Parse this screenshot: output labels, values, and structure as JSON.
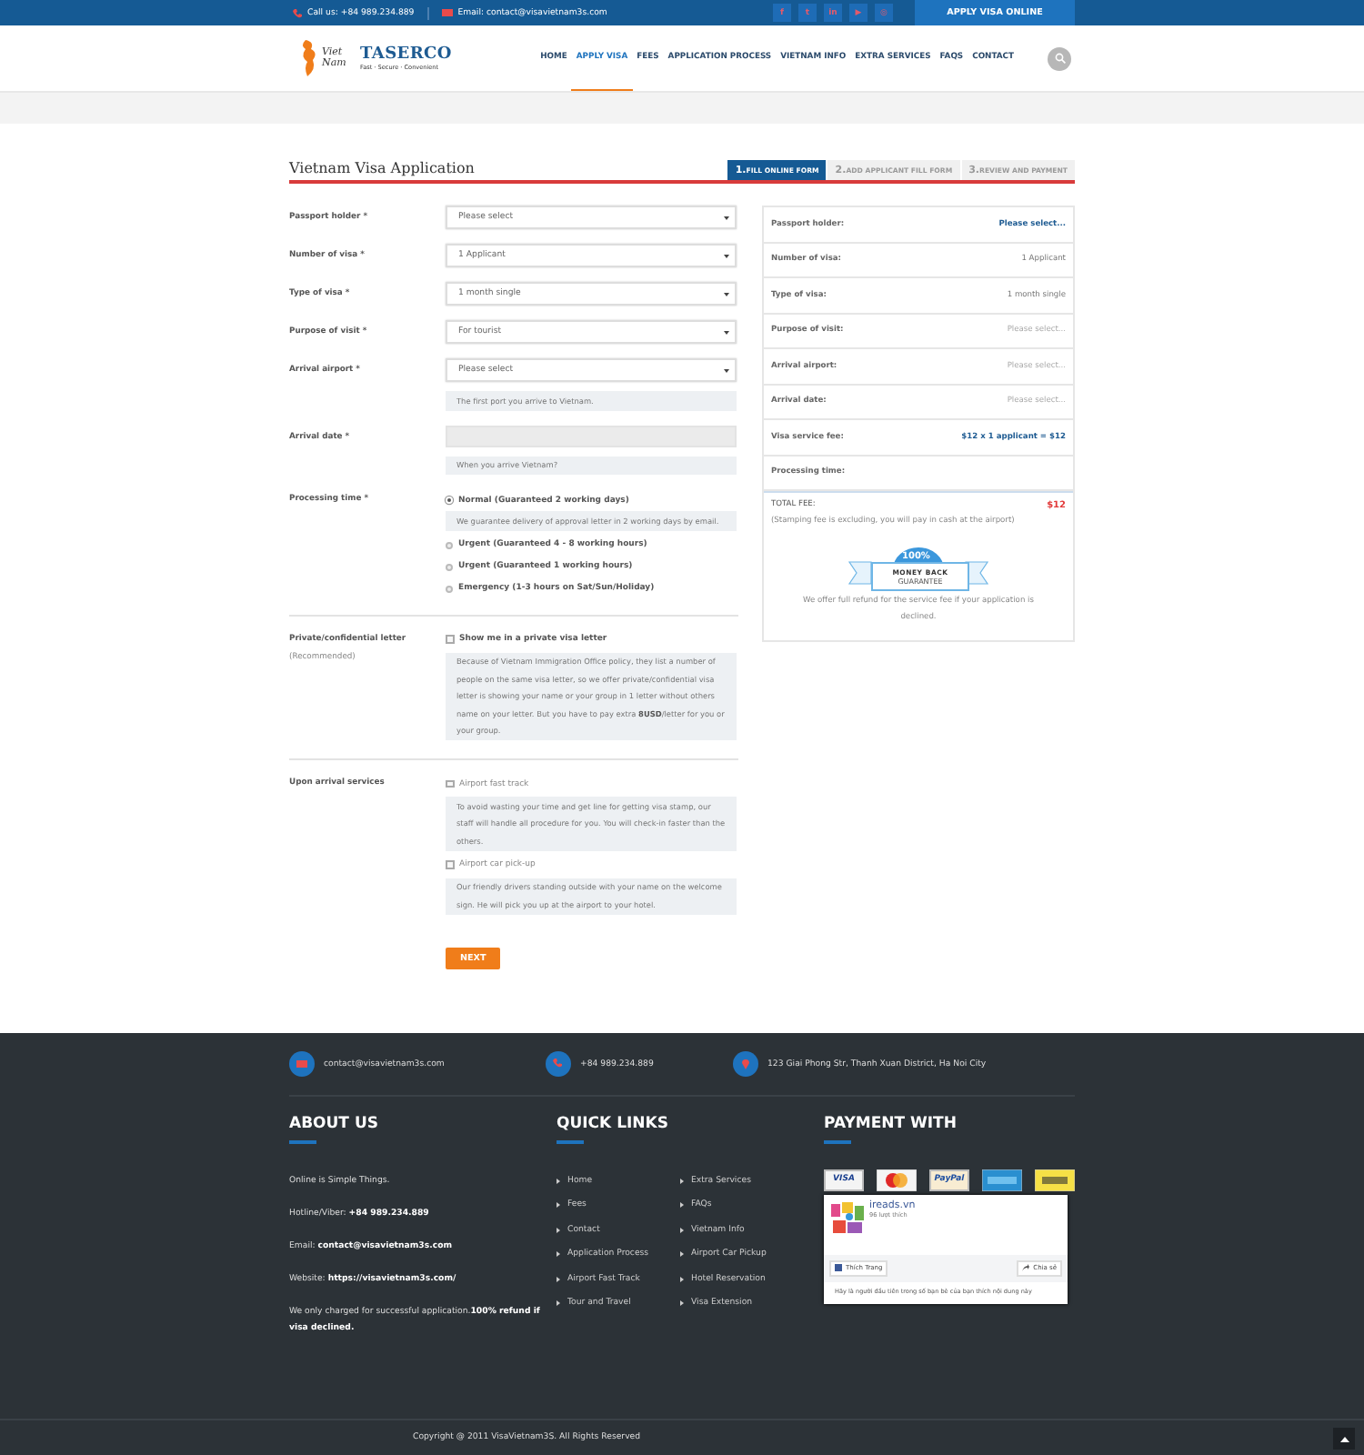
{
  "topbar": {
    "phone": "Call us: +84 989.234.889",
    "email": "Email: contact@visavietnam3s.com",
    "social": [
      {
        "glyph": "f"
      },
      {
        "glyph": "t"
      },
      {
        "glyph": "in"
      },
      {
        "glyph": "▶"
      },
      {
        "glyph": "◎"
      }
    ],
    "apply_button": "APPLY VISA ONLINE"
  },
  "header": {
    "logo": {
      "script": "Viet Nam",
      "name": "TASERCO",
      "tagline": "Fast · Secure · Convenient"
    },
    "nav": [
      {
        "label": "HOME",
        "selected": false
      },
      {
        "label": "APPLY VISA",
        "selected": true
      },
      {
        "label": "FEES",
        "selected": false
      },
      {
        "label": "APPLICATION PROCESS",
        "selected": false
      },
      {
        "label": "VIETNAM INFO",
        "selected": false
      },
      {
        "label": "EXTRA SERVICES",
        "selected": false
      },
      {
        "label": "FAQS",
        "selected": false
      },
      {
        "label": "CONTACT",
        "selected": false
      }
    ]
  },
  "form": {
    "title": "Vietnam Visa Application",
    "steps": [
      {
        "number": "1.",
        "label": "FILL ONLINE FORM",
        "selected": true
      },
      {
        "number": "2.",
        "label": "ADD APPLICANT FILL FORM",
        "selected": false
      },
      {
        "number": "3.",
        "label": "REVIEW AND PAYMENT",
        "selected": false
      }
    ],
    "fields": [
      {
        "kind": "select",
        "label": "Passport holder *",
        "value": "Please select"
      },
      {
        "kind": "select",
        "label": "Number of visa *",
        "value": "1 Applicant"
      },
      {
        "kind": "select",
        "label": "Type of visa *",
        "value": "1 month single"
      },
      {
        "kind": "select",
        "label": "Purpose of visit *",
        "value": "For tourist"
      },
      {
        "kind": "select",
        "label": "Arrival airport *",
        "value": "Please select",
        "hint": "The first port you arrive to Vietnam."
      },
      {
        "kind": "date",
        "label": "Arrival date *",
        "hint": "When you arrive Vietnam?"
      },
      {
        "kind": "radio",
        "label": "Processing time *",
        "options": [
          {
            "label": "Normal (Guaranteed 2 working days)",
            "selected": true,
            "hint": "We guarantee delivery of approval letter in 2 working days by email."
          },
          {
            "label": "Urgent (Guaranteed 4 - 8 working hours)",
            "selected": false
          },
          {
            "label": "Urgent (Guaranteed 1 working hours)",
            "selected": false
          },
          {
            "label": "Emergency (1-3 hours on Sat/Sun/Holiday)",
            "selected": false
          }
        ]
      },
      {
        "kind": "checks",
        "label": "Private/confidential letter",
        "sublabel": "(Recommended)",
        "options": [
          {
            "label": "Show me in a private visa letter",
            "checked": false,
            "emphasis": true,
            "hint": "Because of Vietnam Immigration Office policy, they list a number of people on the same visa letter, so we offer private/confidential visa letter is showing your name or your group in 1 letter without others name on your letter. But you have to pay extra **8USD**/letter for you or your group."
          }
        ]
      },
      {
        "kind": "checks",
        "label": "Upon arrival services",
        "options": [
          {
            "label": "Airport fast track",
            "checked": false,
            "emphasis": false,
            "hint": "To avoid wasting your time and get line for getting visa stamp, our staff will handle all procedure for you. You will check-in faster than the others."
          },
          {
            "label": "Airport car pick-up",
            "checked": false,
            "emphasis": false,
            "hint": "Our friendly drivers standing outside with your name on the welcome sign. He will pick you up at the airport to your hotel."
          }
        ]
      }
    ],
    "next_button": "NEXT"
  },
  "summary": {
    "rows": [
      {
        "label": "Passport holder:",
        "value": "Please select...",
        "kind": "emphasis"
      },
      {
        "label": "Number of visa:",
        "value": "1 Applicant",
        "kind": "value"
      },
      {
        "label": "Type of visa:",
        "value": "1 month single",
        "kind": "value"
      },
      {
        "label": "Purpose of visit:",
        "value": "Please select...",
        "kind": "placeholder"
      },
      {
        "label": "Arrival airport:",
        "value": "Please select...",
        "kind": "placeholder"
      },
      {
        "label": "Arrival date:",
        "value": "Please select...",
        "kind": "placeholder"
      },
      {
        "label": "Visa service fee:",
        "value": "$12 x 1 applicant = $12",
        "kind": "emphasis"
      },
      {
        "label": "Processing time:"
      }
    ],
    "total_label": "TOTAL FEE:",
    "total": "$12",
    "note": "(Stamping fee is excluding, you will pay in cash at the airport)",
    "badge": {
      "percent": "100%",
      "line1": "MONEY BACK",
      "line2": "GUARANTEE"
    },
    "refund": "We offer full refund for the service fee if your application is declined."
  },
  "footer": {
    "contacts": [
      {
        "kind": "mail",
        "text": "contact@visavietnam3s.com"
      },
      {
        "kind": "phone",
        "text": "+84 989.234.889"
      },
      {
        "kind": "pin",
        "text": "123 Giai Phong Str, Thanh Xuan District, Ha Noi City"
      }
    ],
    "about": {
      "heading": "ABOUT US",
      "paragraphs": [
        "Online is Simple Things.",
        "Hotline/Viber: **+84 989.234.889**",
        "Email: **contact@visavietnam3s.com**",
        "Website: **https://visavietnam3s.com/**",
        "We only charged for successful application.**100% refund if visa declined.**"
      ]
    },
    "links": {
      "heading": "QUICK LINKS",
      "columns": [
        [
          "Home",
          "Fees",
          "Contact",
          "Application Process",
          "Airport Fast Track",
          "Tour and Travel"
        ],
        [
          "Extra Services",
          "FAQs",
          "Vietnam Info",
          "Airport Car Pickup",
          "Hotel Reservation",
          "Visa Extension"
        ]
      ]
    },
    "payment": {
      "heading": "PAYMENT WITH",
      "cards": [
        {
          "kind": "visa",
          "text": "VISA"
        },
        {
          "kind": "mastercard"
        },
        {
          "kind": "paypal",
          "text": "PayPal"
        },
        {
          "kind": "amex"
        },
        {
          "kind": "western"
        }
      ],
      "widget": {
        "page": "ireads.vn",
        "likes": "96 lượt thích",
        "like_button": "Thích Trang",
        "share_button": "Chia sẻ",
        "prompt": "Hãy là người đầu tiên trong số bạn bè của bạn thích nội dung này"
      }
    },
    "copyright": "Copyright @ 2011 VisaVietnam3S. All Rights Reserved"
  }
}
